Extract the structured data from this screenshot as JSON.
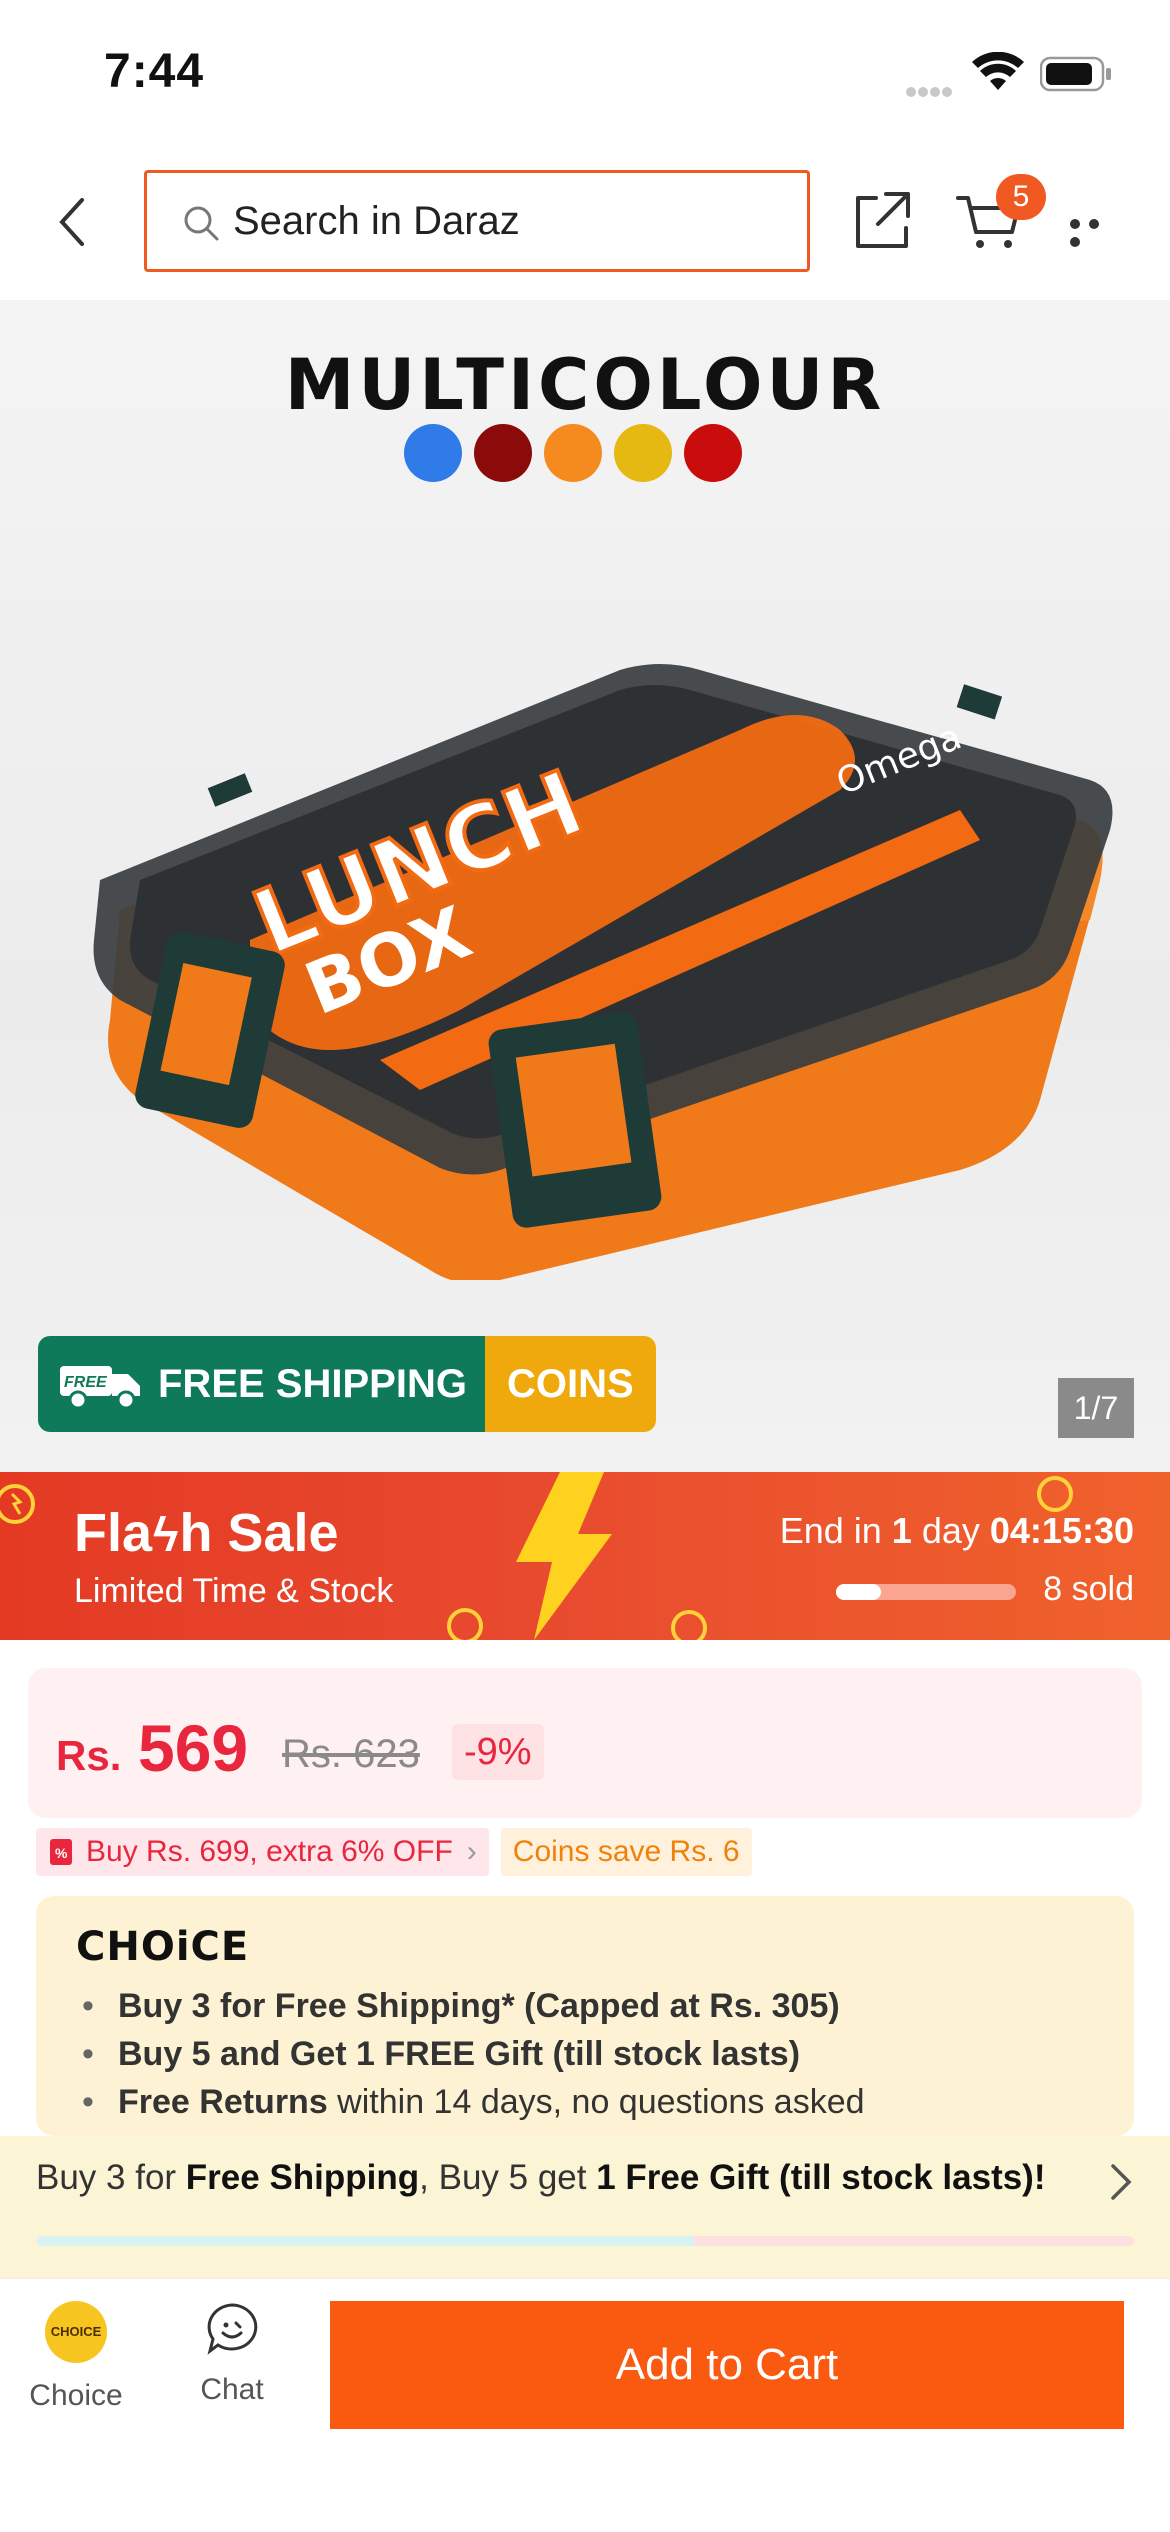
{
  "status_bar": {
    "time": "7:44"
  },
  "header": {
    "search_placeholder": "Search in Daraz",
    "cart_count": "5"
  },
  "product": {
    "image_title": "MULTICOLOUR",
    "colors": [
      "#2f7be8",
      "#8b0a0a",
      "#f58a1f",
      "#e6b812",
      "#c90c0c"
    ],
    "shipping_badge": "FREE SHIPPING",
    "shipping_truck_text": "FREE",
    "coins_badge": "COINS",
    "page_indicator": "1/7",
    "product_print": {
      "lunch": "LUNCH",
      "box": "BOX",
      "brand": "Omega"
    }
  },
  "flash_sale": {
    "title": "Fla",
    "title_end": "h Sale",
    "subtitle": "Limited Time & Stock",
    "end_prefix": "End in",
    "days": "1",
    "day_word": "day",
    "countdown": "04:15:30",
    "sold": "8 sold",
    "sold_progress": 0.25
  },
  "price": {
    "currency": "Rs.",
    "value": "569",
    "original": "Rs. 623",
    "discount": "-9%"
  },
  "promos": {
    "voucher": "Buy Rs. 699, extra 6% OFF",
    "coins": "Coins save Rs. 6"
  },
  "choice": {
    "logo": "CHOiCE",
    "items": [
      {
        "bold": "Buy 3 for  Free Shipping* (Capped at Rs. 305)",
        "rest": ""
      },
      {
        "bold": "Buy 5 and Get 1 FREE Gift (till stock lasts)",
        "rest": ""
      },
      {
        "bold": "Free Returns",
        "rest": " within 14 days, no questions asked"
      }
    ]
  },
  "shipping_banner": {
    "part1": "Buy 3 for ",
    "bold1": "Free Shipping",
    "part2": ", Buy 5 get ",
    "bold2": "1 Free Gift (till stock lasts)!",
    "progress": 0.6
  },
  "bottom_bar": {
    "choice_label": "Choice",
    "choice_badge_text": "CHOICE",
    "chat_label": "Chat",
    "add_to_cart": "Add to Cart"
  }
}
